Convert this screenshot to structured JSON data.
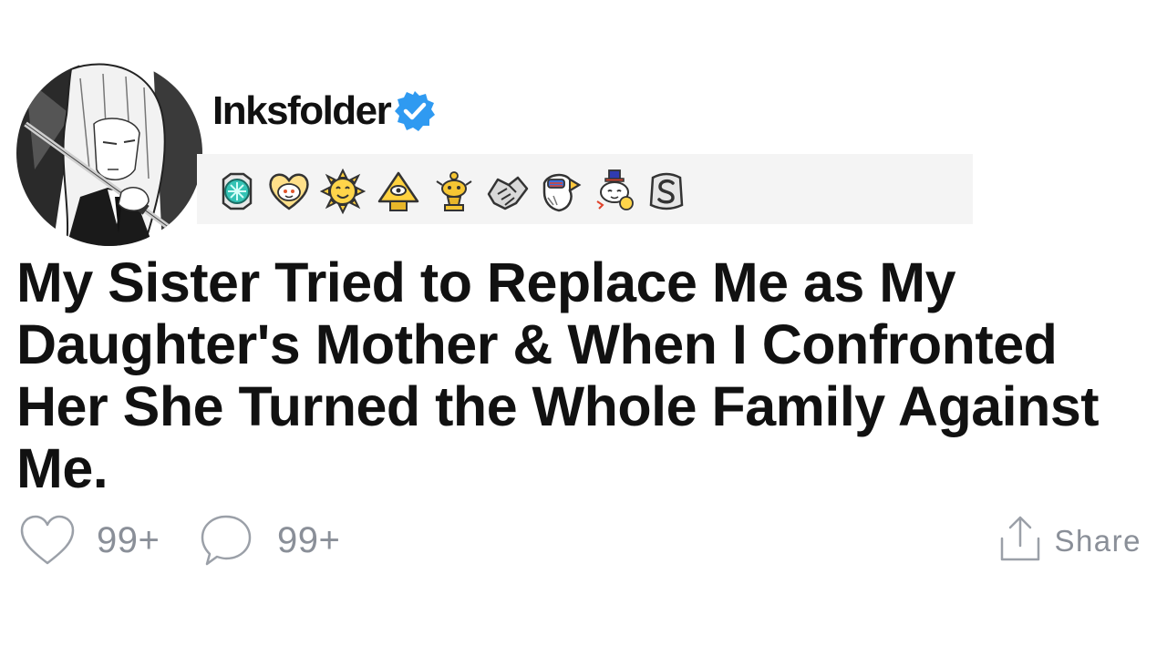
{
  "post": {
    "author": {
      "username": "Inksfolder",
      "verified": true,
      "verified_color": "#2f9af1",
      "avatar_icon": "manga-girl-with-katana-avatar"
    },
    "awards": [
      {
        "name": "teal-gem-award-icon"
      },
      {
        "name": "heart-snoo-award-icon"
      },
      {
        "name": "sun-smile-award-icon"
      },
      {
        "name": "illuminati-pyramid-award-icon"
      },
      {
        "name": "gold-snoo-trophy-award-icon"
      },
      {
        "name": "handshake-award-icon"
      },
      {
        "name": "patriot-eagle-award-icon"
      },
      {
        "name": "snoo-tophat-award-icon"
      },
      {
        "name": "silver-s-coin-award-icon"
      }
    ],
    "title": "My Sister Tried to Replace Me as My Daughter's Mother & When I Confronted Her She Turned the Whole Family Against Me.",
    "actions": {
      "likes_count": "99+",
      "comments_count": "99+",
      "share_label": "Share"
    },
    "colors": {
      "text": "#111111",
      "muted": "#8a8f98",
      "awards_background": "#f4f4f4"
    }
  }
}
